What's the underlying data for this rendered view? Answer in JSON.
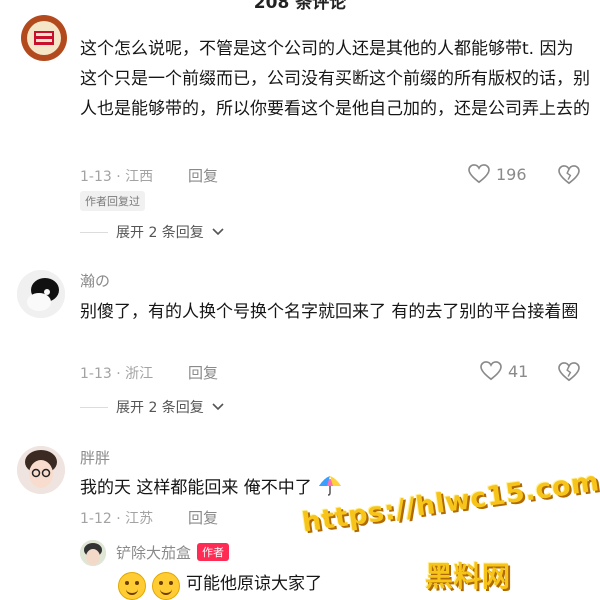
{
  "header": {
    "title": "208 条评论"
  },
  "comments": [
    {
      "username": "",
      "text": "这个怎么说呢，不管是这个公司的人还是其他的人都能够带t. 因为这个只是一个前缀而已，公司没有买断这个前缀的所有版权的话，别人也是能够带的，所以你要看这个是他自己加的，还是公司弄上去的",
      "date_location": "1-13 · 江西",
      "reply_label": "回复",
      "likes": "196",
      "badge": "作者回复过",
      "expand": "展开 2 条回复"
    },
    {
      "username": "瀚の",
      "text": "别傻了，有的人换个号换个名字就回来了 有的去了别的平台接着圈",
      "date_location": "1-13 · 浙江",
      "reply_label": "回复",
      "likes": "41",
      "expand": "展开 2 条回复"
    },
    {
      "username": "胖胖",
      "text": "我的天 这样都能回来 俺不中了",
      "date_location": "1-12 · 江苏",
      "reply_label": "回复"
    }
  ],
  "author_reply": {
    "username": "铲除大茄盒",
    "author_tag": "作者",
    "text": "可能他原谅大家了"
  },
  "watermark": {
    "url": "https://hlwc15.com",
    "name": "黑料网"
  },
  "colors": {
    "accent": "#fe2c55",
    "watermark": "#f7c51a"
  }
}
